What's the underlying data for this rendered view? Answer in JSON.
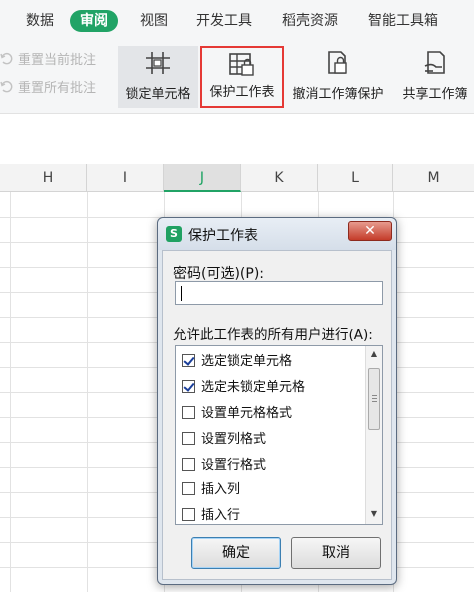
{
  "menu": {
    "tabs": [
      "数据",
      "审阅",
      "视图",
      "开发工具",
      "稻壳资源",
      "智能工具箱"
    ],
    "active_tab": "审阅"
  },
  "ribbon": {
    "reset_current_comment": "重置当前批注",
    "reset_all_comments": "重置所有批注",
    "lock_cells": "锁定单元格",
    "protect_sheet": "保护工作表",
    "unprotect_workbook": "撤消工作簿保护",
    "share_workbook": "共享工作簿"
  },
  "sheet": {
    "columns": [
      "H",
      "I",
      "J",
      "K",
      "L",
      "M"
    ],
    "selected_column": "J"
  },
  "dialog": {
    "title": "保护工作表",
    "app_icon": "S",
    "password_label": "密码(可选)(P):",
    "password_value": "",
    "permissions_label": "允许此工作表的所有用户进行(A):",
    "permissions": [
      {
        "label": "选定锁定单元格",
        "checked": true
      },
      {
        "label": "选定未锁定单元格",
        "checked": true
      },
      {
        "label": "设置单元格格式",
        "checked": false
      },
      {
        "label": "设置列格式",
        "checked": false
      },
      {
        "label": "设置行格式",
        "checked": false
      },
      {
        "label": "插入列",
        "checked": false
      },
      {
        "label": "插入行",
        "checked": false
      }
    ],
    "ok_label": "确定",
    "cancel_label": "取消",
    "close_label": "✕"
  },
  "colors": {
    "accent_green": "#21a366",
    "highlight_red": "#e53935"
  }
}
